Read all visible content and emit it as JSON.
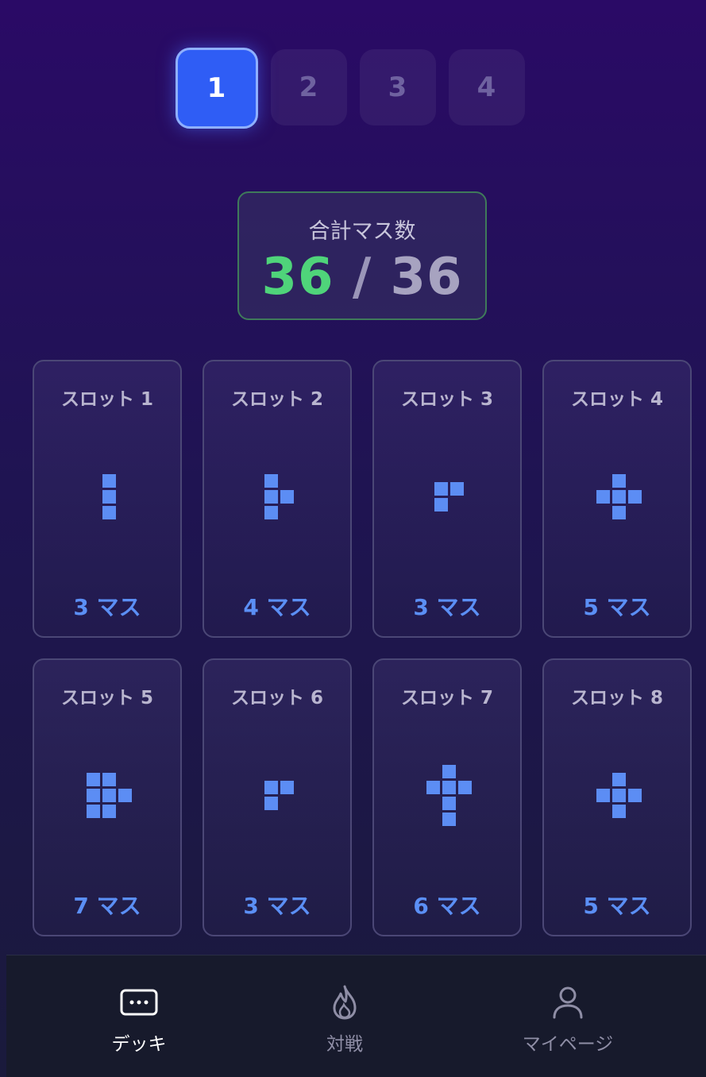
{
  "deck_tabs": [
    "1",
    "2",
    "3",
    "4"
  ],
  "active_tab": "1",
  "total": {
    "label": "合計マス数",
    "current": "36",
    "separator": "/",
    "max": "36"
  },
  "slots": [
    {
      "title": "スロット 1",
      "count": "3 マス"
    },
    {
      "title": "スロット 2",
      "count": "4 マス"
    },
    {
      "title": "スロット 3",
      "count": "3 マス"
    },
    {
      "title": "スロット 4",
      "count": "5 マス"
    },
    {
      "title": "スロット 5",
      "count": "7 マス"
    },
    {
      "title": "スロット 6",
      "count": "3 マス"
    },
    {
      "title": "スロット 7",
      "count": "6 マス"
    },
    {
      "title": "スロット 8",
      "count": "5 マス"
    }
  ],
  "nav": [
    {
      "label": "デッキ",
      "icon": "deck-icon"
    },
    {
      "label": "対戦",
      "icon": "flame-icon"
    },
    {
      "label": "マイページ",
      "icon": "user-icon"
    }
  ],
  "colors": {
    "accent": "#2f5df5",
    "cell": "#5c8df4",
    "total_ok": "#4fd47a"
  }
}
